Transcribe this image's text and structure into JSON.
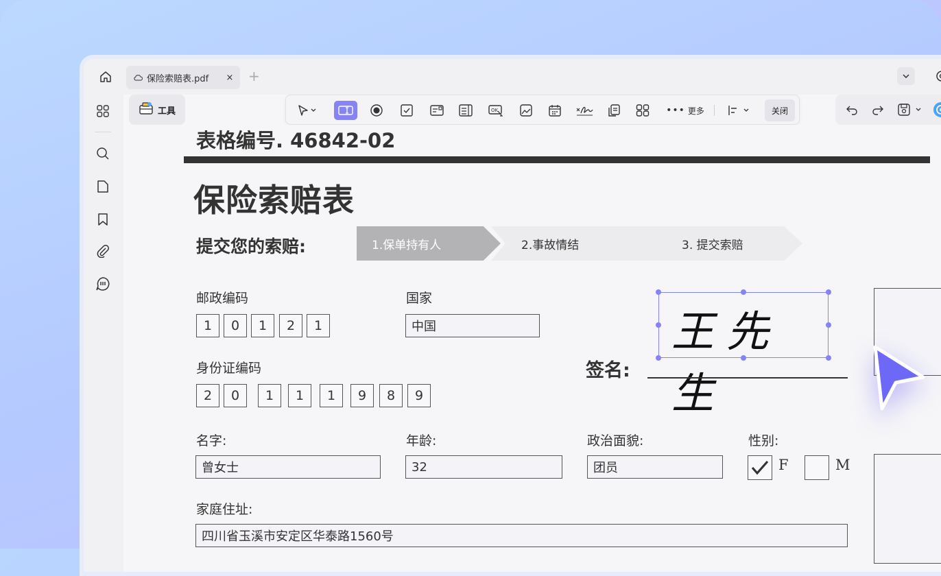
{
  "tab": {
    "title": "保险索赔表.pdf",
    "close": "×"
  },
  "new_tab": "+",
  "tool_button": {
    "label": "工具"
  },
  "toolbar": {
    "more_label": "更多",
    "close_label": "关闭"
  },
  "document": {
    "form_number": "表格编号. 46842-02",
    "title": "保险索赔表",
    "submit_label": "提交您的索赔:",
    "steps": [
      "1.保单持有人",
      "2.事故情结",
      "3. 提交索赔"
    ],
    "postal_code": {
      "label": "邮政编码",
      "digits": [
        "1",
        "0",
        "1",
        "2",
        "1"
      ]
    },
    "country": {
      "label": "国家",
      "value": "中国"
    },
    "id_number": {
      "label": "身份证编码",
      "digits": [
        "2",
        "0",
        "1",
        "1",
        "1",
        "9",
        "8",
        "9"
      ]
    },
    "signature": {
      "label": "签名:",
      "value": "王先生"
    },
    "name": {
      "label": "名字:",
      "value": "曾女士"
    },
    "age": {
      "label": "年龄:",
      "value": "32"
    },
    "political_status": {
      "label": "政治面貌:",
      "value": "团员"
    },
    "gender": {
      "label": "性别:",
      "options": [
        "F",
        "M"
      ],
      "selected": "F"
    },
    "address": {
      "label": "家庭住址:",
      "value": "四川省玉溪市安定区华泰路1560号"
    }
  },
  "colors": {
    "accent": "#8684f5",
    "cursor": "#6d68f5",
    "text": "#333333"
  }
}
